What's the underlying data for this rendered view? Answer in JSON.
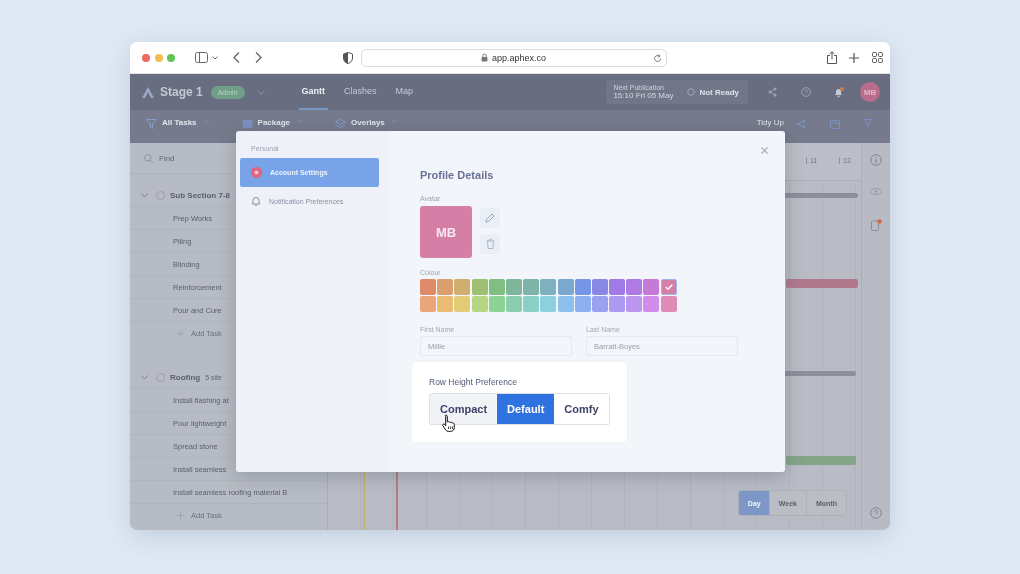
{
  "browser": {
    "url": "app.aphex.co"
  },
  "app_header": {
    "project": "Stage 1",
    "role_badge": "Admin",
    "tabs": [
      {
        "label": "Gantt",
        "selected": true
      },
      {
        "label": "Clashes",
        "selected": false
      },
      {
        "label": "Map",
        "selected": false
      }
    ],
    "publication": {
      "label": "Next Publication",
      "time": "15:10 Fri 05 May",
      "status": "Not Ready"
    },
    "avatar": "MB"
  },
  "toolbar": {
    "items": [
      "All Tasks",
      "Package",
      "Overlays"
    ],
    "tidy_up": "Tidy Up"
  },
  "task_panel": {
    "search": {
      "placeholder": "Find"
    },
    "sections": [
      {
        "name": "Sub Section 7-8",
        "tasks": [
          "Prep Works",
          "Piling",
          "Blinding",
          "Reinforcement",
          "Pour and Cure"
        ],
        "add_task": "Add Task"
      },
      {
        "name": "Roofing",
        "meta": "5 site",
        "tasks": [
          "Install flashing at",
          "Pour lightweight",
          "Spread stone",
          "Install seamless",
          "Install seamless roofing material B"
        ],
        "add_task": "Add Task"
      }
    ]
  },
  "gantt": {
    "columns": [
      "11",
      "12"
    ],
    "bars": [
      {
        "color": "#8d909b"
      },
      {
        "color": "#b07a8c"
      },
      {
        "color": "#8d909b"
      },
      {
        "color": "#84a588"
      }
    ],
    "view_buttons": [
      {
        "label": "Day",
        "selected": true
      },
      {
        "label": "Week",
        "selected": false
      },
      {
        "label": "Month",
        "selected": false
      }
    ]
  },
  "settings_modal": {
    "nav_heading": "Personal",
    "nav": [
      {
        "label": "Account Settings",
        "selected": true
      },
      {
        "label": "Notification Preferences",
        "selected": false
      }
    ],
    "title": "Profile Details",
    "avatar_label": "Avatar",
    "avatar_initials": "MB",
    "colour_label": "Colour",
    "swatches": [
      [
        {
          "color": "#e08a6a",
          "selected": false
        },
        {
          "color": "#d9a06d",
          "selected": false
        },
        {
          "color": "#cfae6e",
          "selected": false
        },
        {
          "color": "#9fbf72",
          "selected": false
        },
        {
          "color": "#7fbf82",
          "selected": false
        },
        {
          "color": "#7fb59a",
          "selected": false
        },
        {
          "color": "#7fb2a8",
          "selected": false
        },
        {
          "color": "#7fb0c0",
          "selected": false
        },
        {
          "color": "#7aa8d0",
          "selected": false
        },
        {
          "color": "#7795e8",
          "selected": false
        },
        {
          "color": "#8a88e6",
          "selected": false
        },
        {
          "color": "#a07ae6",
          "selected": false
        },
        {
          "color": "#b07ae4",
          "selected": false
        },
        {
          "color": "#c67ad8",
          "selected": false
        },
        {
          "color": "#d57fa6",
          "selected": true
        }
      ],
      [
        {
          "color": "#eca47a",
          "selected": false
        },
        {
          "color": "#ebbc74",
          "selected": false
        },
        {
          "color": "#e4cc76",
          "selected": false
        },
        {
          "color": "#b5d683",
          "selected": false
        },
        {
          "color": "#8ed392",
          "selected": false
        },
        {
          "color": "#8ccfb0",
          "selected": false
        },
        {
          "color": "#8ad0c8",
          "selected": false
        },
        {
          "color": "#8ccfe0",
          "selected": false
        },
        {
          "color": "#8cc0ee",
          "selected": false
        },
        {
          "color": "#8eaef2",
          "selected": false
        },
        {
          "color": "#9aa3ef",
          "selected": false
        },
        {
          "color": "#ad9af0",
          "selected": false
        },
        {
          "color": "#bc95ef",
          "selected": false
        },
        {
          "color": "#d48cec",
          "selected": false
        },
        {
          "color": "#e08cb9",
          "selected": false
        }
      ]
    ],
    "fields": [
      {
        "label": "First Name",
        "value": "Millie"
      },
      {
        "label": "Last Name",
        "value": "Barratt-Boyes"
      }
    ],
    "row_height": {
      "label": "Row Height Preference",
      "options": [
        {
          "label": "Compact",
          "selected": false,
          "hovered": true
        },
        {
          "label": "Default",
          "selected": true,
          "hovered": false
        },
        {
          "label": "Comfy",
          "selected": false,
          "hovered": false
        }
      ]
    }
  }
}
